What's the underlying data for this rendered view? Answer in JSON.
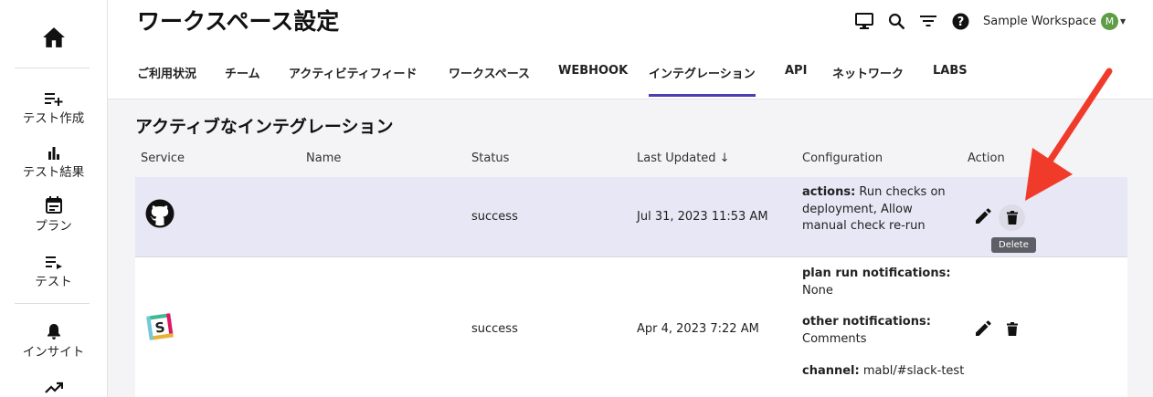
{
  "sidebar": {
    "items": [
      {
        "label": "テスト作成",
        "icon": "playlist-add-icon"
      },
      {
        "label": "テスト結果",
        "icon": "bar-chart-icon"
      },
      {
        "label": "プラン",
        "icon": "calendar-icon"
      },
      {
        "label": "テスト",
        "icon": "playlist-play-icon"
      },
      {
        "label": "インサイト",
        "icon": "bell-icon"
      }
    ]
  },
  "header": {
    "title": "ワークスペース設定",
    "workspace_name": "Sample Workspace",
    "avatar_initial": "M"
  },
  "tabs": [
    {
      "label": "ご利用状況"
    },
    {
      "label": "チーム"
    },
    {
      "label": "アクティビティフィード"
    },
    {
      "label": "ワークスペース"
    },
    {
      "label": "WEBHOOK"
    },
    {
      "label": "インテグレーション",
      "active": true
    },
    {
      "label": "API"
    },
    {
      "label": "ネットワーク"
    },
    {
      "label": "LABS"
    }
  ],
  "section_title": "アクティブなインテグレーション",
  "table": {
    "headers": {
      "service": "Service",
      "name": "Name",
      "status": "Status",
      "last_updated": "Last Updated ↓",
      "configuration": "Configuration",
      "action": "Action"
    },
    "rows": [
      {
        "service_icon": "github-icon",
        "name": "",
        "status": "success",
        "last_updated": "Jul 31, 2023 11:53 AM",
        "config": [
          {
            "key": "actions:",
            "value": " Run checks on deployment, Allow manual check re-run"
          }
        ]
      },
      {
        "service_icon": "slack-icon",
        "name": "",
        "status": "success",
        "last_updated": "Apr 4, 2023 7:22 AM",
        "config": [
          {
            "key": "plan run notifications:",
            "value": "None"
          },
          {
            "key": "other notifications:",
            "value": "Comments"
          },
          {
            "key": "channel:",
            "value": " mabl/#slack-test"
          }
        ]
      }
    ]
  },
  "tooltip": "Delete",
  "colors": {
    "accent": "#4b3fb0",
    "highlight_row": "#e8e7f5",
    "annotation_arrow": "#f03b2a"
  }
}
